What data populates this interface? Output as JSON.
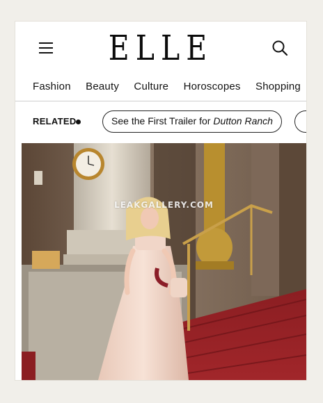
{
  "header": {
    "logo": "ELLE",
    "menu_icon": "hamburger-menu-icon",
    "search_icon": "search-icon"
  },
  "nav": {
    "items": [
      "Fashion",
      "Beauty",
      "Culture",
      "Horoscopes",
      "Shopping"
    ]
  },
  "related": {
    "label": "RELATED",
    "link_prefix": "See the First Trailer for ",
    "link_title": "Dutton Ranch"
  },
  "photo": {
    "watermark": "LEAKGALLERY.COM"
  }
}
